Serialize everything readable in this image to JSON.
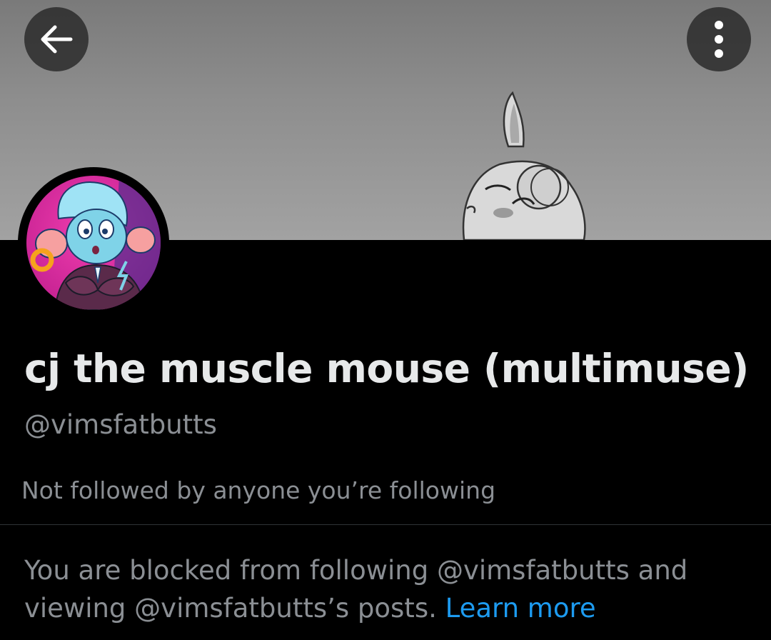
{
  "header": {
    "back_icon": "arrow-left-icon",
    "more_icon": "more-vertical-icon"
  },
  "profile": {
    "display_name": "cj the muscle mouse (multimuse)",
    "handle": "@vimsfatbutts",
    "followed_by": "Not followed by anyone you’re following"
  },
  "blocked": {
    "text": "You are blocked from following @vimsfatbutts and viewing @vimsfatbutts’s posts.",
    "link": "Learn more"
  },
  "colors": {
    "background": "#000000",
    "text_primary": "#e7e9ea",
    "text_secondary": "#8b8f94",
    "link": "#1d9bf0",
    "divider": "#2f3336",
    "avatar_pink": "#d82aa6"
  }
}
